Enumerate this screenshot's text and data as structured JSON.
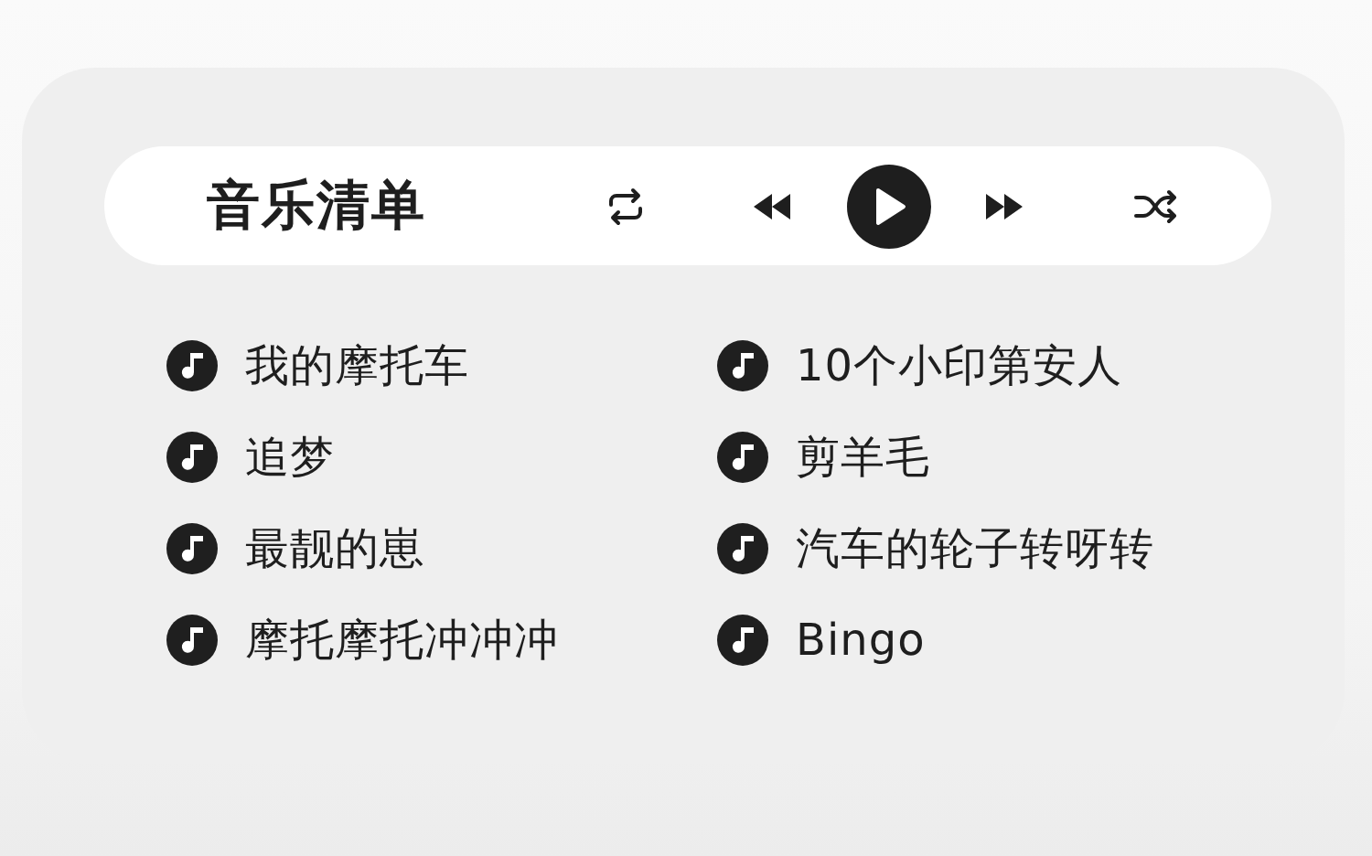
{
  "header": {
    "title": "音乐清单"
  },
  "songs": [
    {
      "title": "我的摩托车"
    },
    {
      "title": "10个小印第安人"
    },
    {
      "title": "追梦"
    },
    {
      "title": "剪羊毛"
    },
    {
      "title": "最靓的崽"
    },
    {
      "title": "汽车的轮子转呀转"
    },
    {
      "title": "摩托摩托冲冲冲"
    },
    {
      "title": "Bingo"
    }
  ]
}
